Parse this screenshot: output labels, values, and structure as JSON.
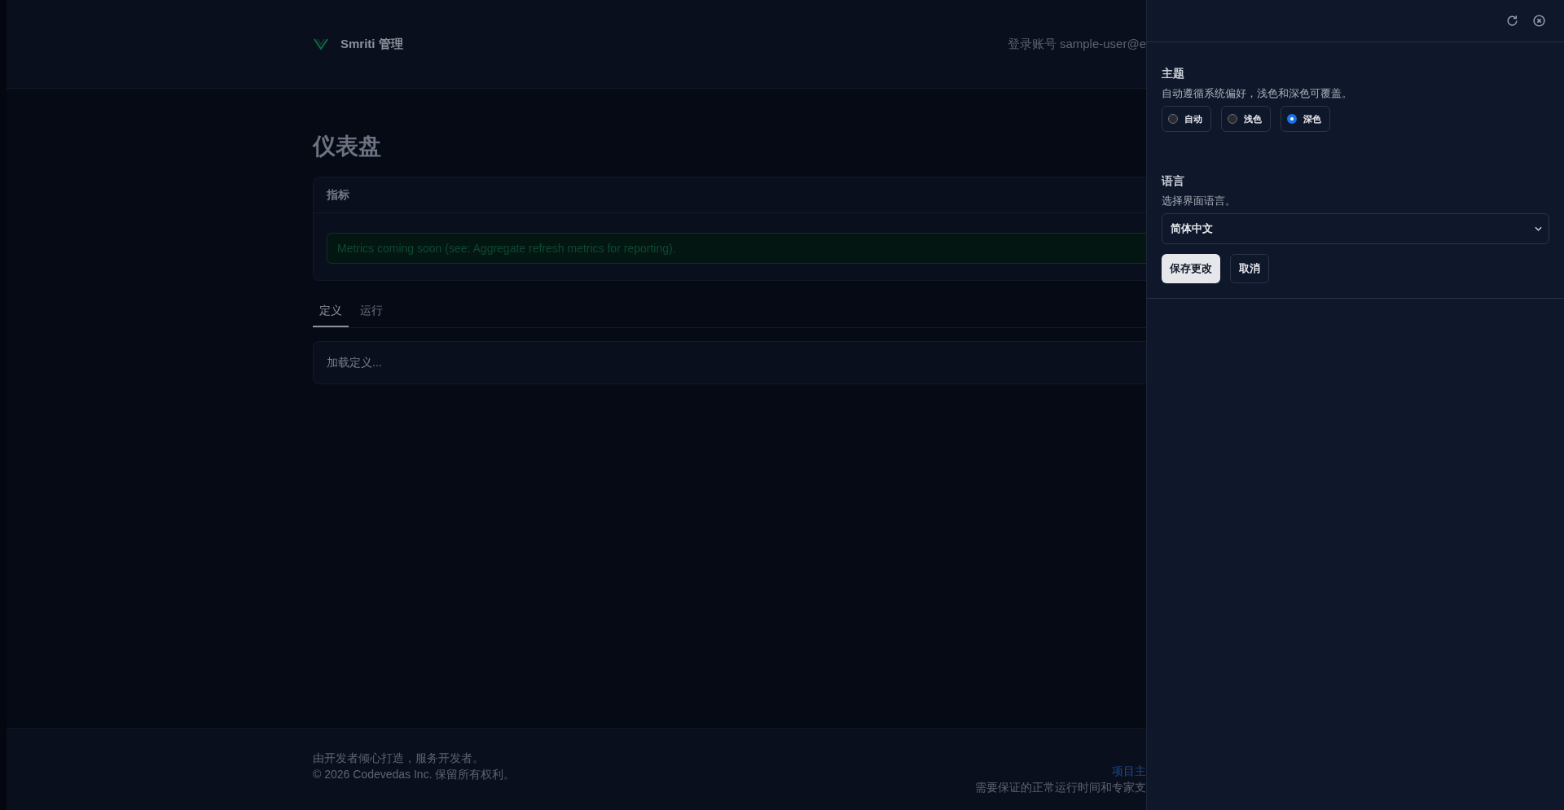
{
  "header": {
    "brand": "Smriti 管理",
    "account": "登录账号 sample-user@e"
  },
  "page": {
    "title": "仪表盘",
    "metrics_card": {
      "title": "指标",
      "notice": "Metrics coming soon (see: Aggregate refresh metrics for reporting)."
    },
    "tabs": [
      {
        "label": "定义",
        "selected": true
      },
      {
        "label": "运行",
        "selected": false
      }
    ],
    "loading_text": "加载定义..."
  },
  "footer": {
    "tagline": "由开发者倾心打造，服务开发者。",
    "copyright": "© 2026 Codevedas Inc. 保留所有权利。",
    "link": "项目主",
    "support": "需要保证的正常运行时间和专家支"
  },
  "settings_panel": {
    "theme": {
      "title": "主题",
      "description": "自动遵循系统偏好，浅色和深色可覆盖。",
      "options": [
        {
          "label": "自动",
          "selected": false
        },
        {
          "label": "浅色",
          "selected": false
        },
        {
          "label": "深色",
          "selected": true
        }
      ]
    },
    "language": {
      "title": "语言",
      "description": "选择界面语言。",
      "value": "简体中文"
    },
    "buttons": [
      {
        "label": "保存更改",
        "kind": "primary"
      },
      {
        "label": "取消",
        "kind": "secondary"
      }
    ]
  }
}
